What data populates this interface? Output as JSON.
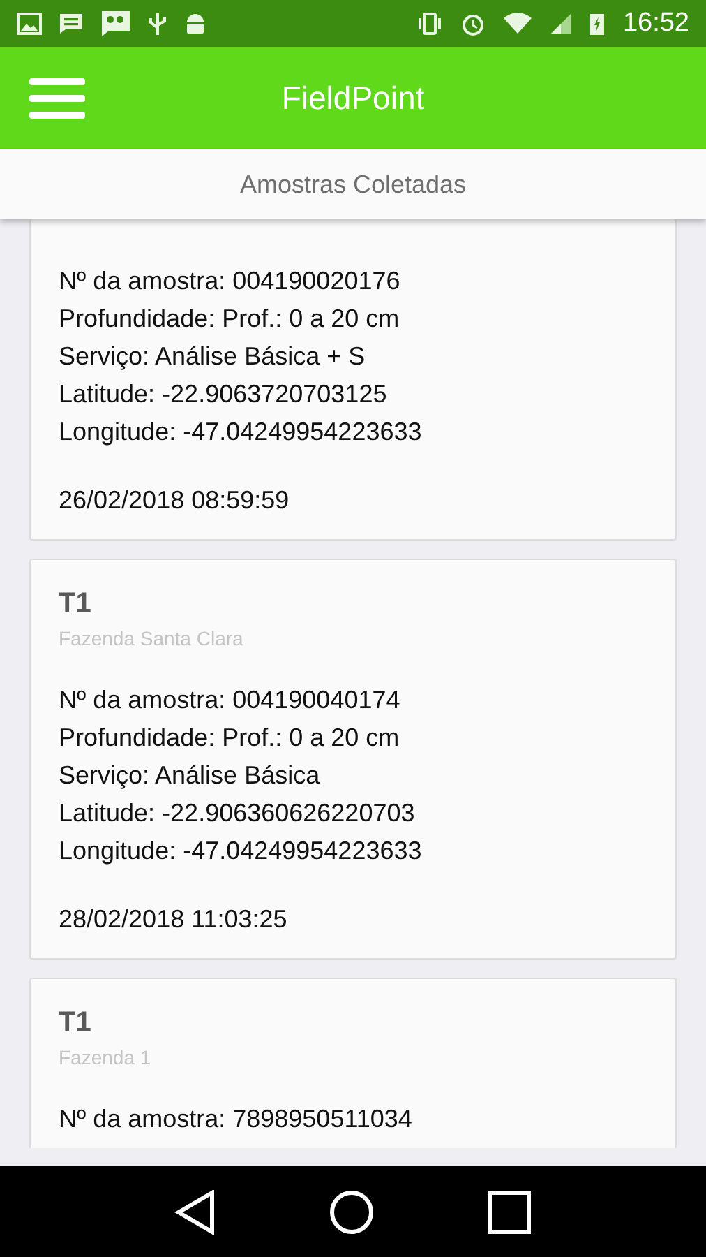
{
  "status_bar": {
    "time": "16:52"
  },
  "app_bar": {
    "title": "FieldPoint"
  },
  "subheader": {
    "title": "Amostras Coletadas"
  },
  "samples": [
    {
      "lines": [
        "Nº da amostra: 004190020176",
        "Profundidade: Prof.: 0 a 20 cm",
        "Serviço: Análise Básica + S",
        "Latitude: -22.9063720703125",
        "Longitude: -47.04249954223633"
      ],
      "date": "26/02/2018 08:59:59"
    },
    {
      "title": "T1",
      "farm": "Fazenda Santa Clara",
      "lines": [
        "Nº da amostra: 004190040174",
        "Profundidade: Prof.: 0 a 20 cm",
        "Serviço: Análise Básica",
        "Latitude: -22.906360626220703",
        "Longitude: -47.04249954223633"
      ],
      "date": "28/02/2018 11:03:25"
    },
    {
      "title": "T1",
      "farm": "Fazenda 1",
      "lines": [
        "Nº da amostra: 7898950511034"
      ]
    }
  ]
}
